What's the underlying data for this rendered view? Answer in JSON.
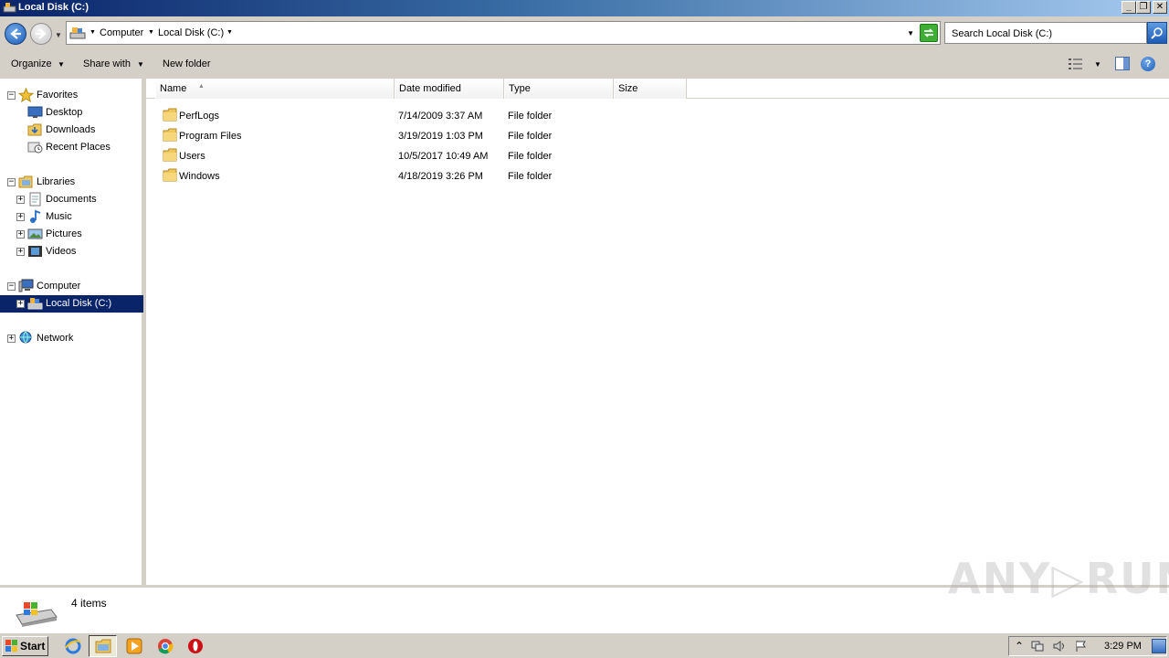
{
  "window": {
    "title": "Local Disk (C:)",
    "buttons": {
      "minimize": "_",
      "restore": "❐",
      "close": "✕"
    }
  },
  "address": {
    "crumbs": [
      "Computer",
      "Local Disk (C:)"
    ],
    "search_placeholder": "Search Local Disk (C:)"
  },
  "toolbar": {
    "organize": "Organize",
    "share_with": "Share with",
    "new_folder": "New folder",
    "help": "?"
  },
  "nav": {
    "favorites": {
      "label": "Favorites",
      "items": [
        "Desktop",
        "Downloads",
        "Recent Places"
      ]
    },
    "libraries": {
      "label": "Libraries",
      "items": [
        "Documents",
        "Music",
        "Pictures",
        "Videos"
      ]
    },
    "computer": {
      "label": "Computer",
      "items": [
        "Local Disk (C:)"
      ]
    },
    "network": {
      "label": "Network"
    },
    "expand_glyph": "+",
    "collapse_glyph": "−"
  },
  "columns": [
    "Name",
    "Date modified",
    "Type",
    "Size"
  ],
  "files": [
    {
      "name": "PerfLogs",
      "date": "7/14/2009 3:37 AM",
      "type": "File folder",
      "size": ""
    },
    {
      "name": "Program Files",
      "date": "3/19/2019 1:03 PM",
      "type": "File folder",
      "size": ""
    },
    {
      "name": "Users",
      "date": "10/5/2017 10:49 AM",
      "type": "File folder",
      "size": ""
    },
    {
      "name": "Windows",
      "date": "4/18/2019 3:26 PM",
      "type": "File folder",
      "size": ""
    }
  ],
  "status": {
    "item_count": "4 items"
  },
  "watermark": "ANY▷RUN",
  "taskbar": {
    "start_label": "Start",
    "clock": "3:29 PM"
  },
  "colors": {
    "title_gradient_start": "#0a246a",
    "selection": "#0a246a",
    "chrome": "#d4d0c8",
    "folder": "#f0c85a"
  }
}
